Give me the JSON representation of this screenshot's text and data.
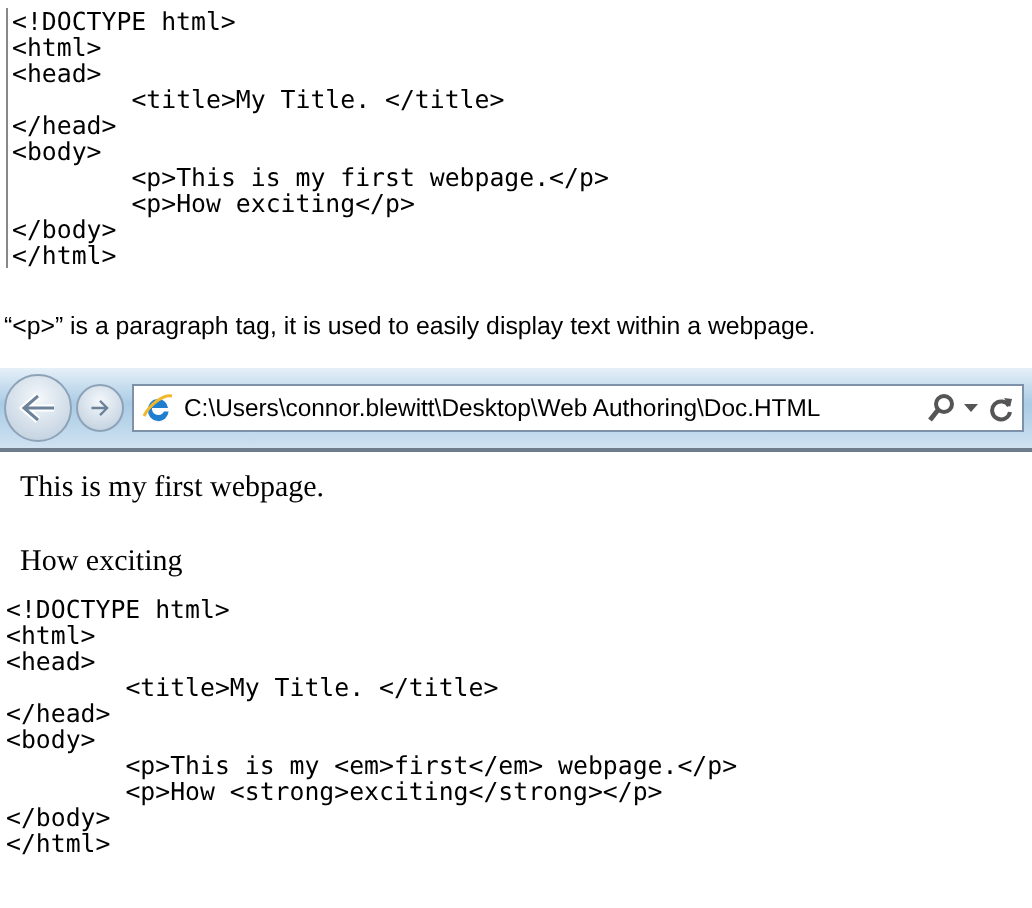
{
  "code_listing_1": {
    "lines": [
      "<!DOCTYPE html>",
      "<html>",
      "<head>",
      "\t<title>My Title. </title>",
      "</head>",
      "<body>",
      "\t<p>This is my first webpage.</p>",
      "\t<p>How exciting</p>",
      "</body>",
      "</html>"
    ]
  },
  "caption": "“<p>” is a paragraph tag, it is used to easily display text within a webpage.",
  "browser": {
    "address": "C:\\Users\\connor.blewitt\\Desktop\\Web Authoring\\Doc.HTML",
    "page_paragraphs": [
      "This is my first webpage.",
      "How exciting"
    ]
  },
  "code_listing_2": {
    "lines": [
      "<!DOCTYPE html>",
      "<html>",
      "<head>",
      "\t<title>My Title. </title>",
      "</head>",
      "<body>",
      "\t<p>This is my <em>first</em> webpage.</p>",
      "\t<p>How <strong>exciting</strong></p>",
      "</body>",
      "</html>"
    ]
  }
}
